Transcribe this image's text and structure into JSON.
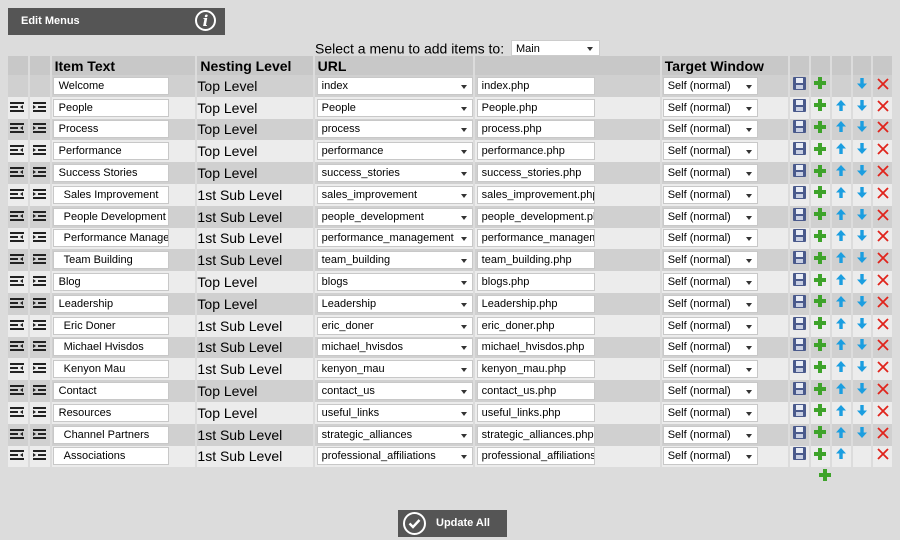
{
  "header": {
    "title": "Edit Menus",
    "info_icon": "info-icon"
  },
  "menu_selector": {
    "label": "Select a menu to add items to:",
    "selected": "Main"
  },
  "table": {
    "columns": [
      "Item Text",
      "Nesting Level",
      "URL",
      "Target Window"
    ],
    "rows": [
      {
        "text": "Welcome",
        "sub": false,
        "nesting": "Top Level",
        "url": "index",
        "file": "index.php",
        "target": "Self (normal)",
        "outdent": false,
        "up": false,
        "down": true
      },
      {
        "text": "People",
        "sub": false,
        "nesting": "Top Level",
        "url": "People",
        "file": "People.php",
        "target": "Self (normal)",
        "outdent": true,
        "up": true,
        "down": true
      },
      {
        "text": "Process",
        "sub": false,
        "nesting": "Top Level",
        "url": "process",
        "file": "process.php",
        "target": "Self (normal)",
        "outdent": true,
        "up": true,
        "down": true
      },
      {
        "text": "Performance",
        "sub": false,
        "nesting": "Top Level",
        "url": "performance",
        "file": "performance.php",
        "target": "Self (normal)",
        "outdent": true,
        "up": true,
        "down": true
      },
      {
        "text": "Success Stories",
        "sub": false,
        "nesting": "Top Level",
        "url": "success_stories",
        "file": "success_stories.php",
        "target": "Self (normal)",
        "outdent": true,
        "up": true,
        "down": true
      },
      {
        "text": "Sales Improvement",
        "sub": true,
        "nesting": "1st Sub Level",
        "url": "sales_improvement",
        "file": "sales_improvement.php",
        "target": "Self (normal)",
        "outdent": true,
        "up": true,
        "down": true
      },
      {
        "text": "People Development",
        "sub": true,
        "nesting": "1st Sub Level",
        "url": "people_development",
        "file": "people_development.php",
        "target": "Self (normal)",
        "outdent": true,
        "up": true,
        "down": true
      },
      {
        "text": "Performance Management",
        "sub": true,
        "nesting": "1st Sub Level",
        "url": "performance_management",
        "file": "performance_management.php",
        "target": "Self (normal)",
        "outdent": true,
        "up": true,
        "down": true
      },
      {
        "text": "Team Building",
        "sub": true,
        "nesting": "1st Sub Level",
        "url": "team_building",
        "file": "team_building.php",
        "target": "Self (normal)",
        "outdent": true,
        "up": true,
        "down": true
      },
      {
        "text": "Blog",
        "sub": false,
        "nesting": "Top Level",
        "url": "blogs",
        "file": "blogs.php",
        "target": "Self (normal)",
        "outdent": true,
        "up": true,
        "down": true
      },
      {
        "text": "Leadership",
        "sub": false,
        "nesting": "Top Level",
        "url": "Leadership",
        "file": "Leadership.php",
        "target": "Self (normal)",
        "outdent": true,
        "up": true,
        "down": true
      },
      {
        "text": "Eric Doner",
        "sub": true,
        "nesting": "1st Sub Level",
        "url": "eric_doner",
        "file": "eric_doner.php",
        "target": "Self (normal)",
        "outdent": true,
        "up": true,
        "down": true
      },
      {
        "text": "Michael Hvisdos",
        "sub": true,
        "nesting": "1st Sub Level",
        "url": "michael_hvisdos",
        "file": "michael_hvisdos.php",
        "target": "Self (normal)",
        "outdent": true,
        "up": true,
        "down": true
      },
      {
        "text": "Kenyon Mau",
        "sub": true,
        "nesting": "1st Sub Level",
        "url": "kenyon_mau",
        "file": "kenyon_mau.php",
        "target": "Self (normal)",
        "outdent": true,
        "up": true,
        "down": true
      },
      {
        "text": "Contact",
        "sub": false,
        "nesting": "Top Level",
        "url": "contact_us",
        "file": "contact_us.php",
        "target": "Self (normal)",
        "outdent": true,
        "up": true,
        "down": true
      },
      {
        "text": "Resources",
        "sub": false,
        "nesting": "Top Level",
        "url": "useful_links",
        "file": "useful_links.php",
        "target": "Self (normal)",
        "outdent": true,
        "up": true,
        "down": true
      },
      {
        "text": "Channel Partners",
        "sub": true,
        "nesting": "1st Sub Level",
        "url": "strategic_alliances",
        "file": "strategic_alliances.php",
        "target": "Self (normal)",
        "outdent": true,
        "up": true,
        "down": true
      },
      {
        "text": "Associations",
        "sub": true,
        "nesting": "1st Sub Level",
        "url": "professional_affiliations",
        "file": "professional_affiliations.php",
        "target": "Self (normal)",
        "outdent": true,
        "up": true,
        "down": false
      }
    ]
  },
  "colors": {
    "save": "#4a5a8c",
    "add": "#3ea32a",
    "arrow": "#1b9ee0",
    "delete": "#e0241c",
    "dark_bar": "#555555"
  },
  "footer": {
    "update_label": "Update All"
  }
}
